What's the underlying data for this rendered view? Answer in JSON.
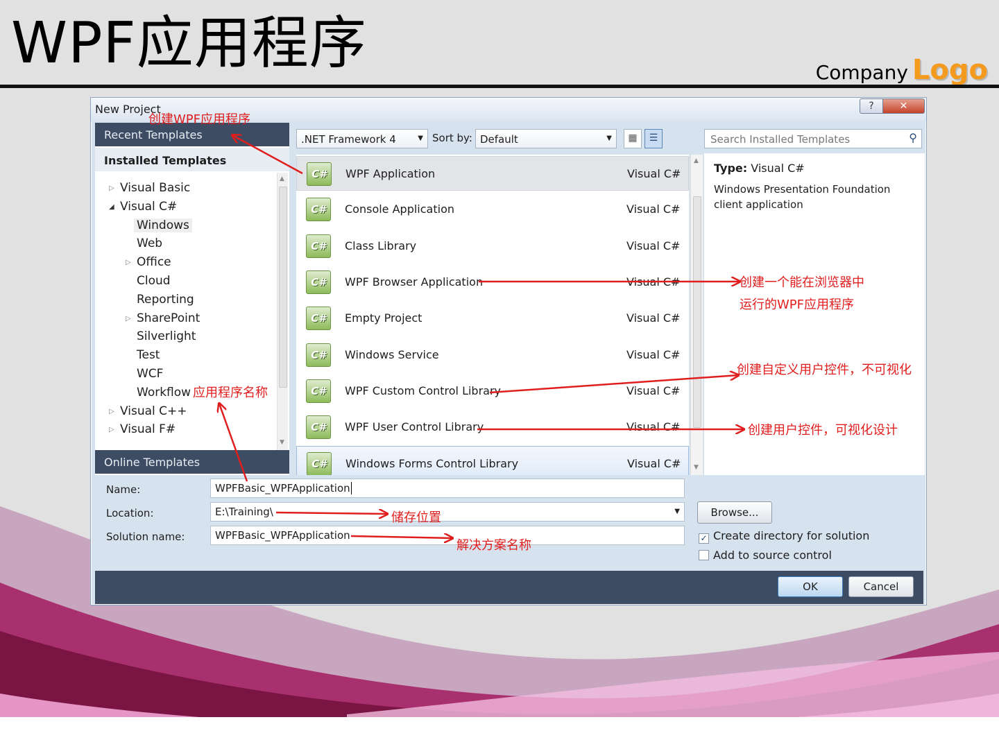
{
  "slide": {
    "title": "WPF应用程序",
    "company": "Company",
    "logo": "Logo"
  },
  "dialog": {
    "title": "New Project",
    "help_icon": "?",
    "close_icon": "✕",
    "left": {
      "recent_templates": "Recent Templates",
      "installed_templates": "Installed Templates",
      "tree": [
        {
          "label": "Visual Basic",
          "level": 0,
          "arrow": "collapsed"
        },
        {
          "label": "Visual C#",
          "level": 0,
          "arrow": "expanded"
        },
        {
          "label": "Windows",
          "level": 1,
          "arrow": "none",
          "selected": true
        },
        {
          "label": "Web",
          "level": 1,
          "arrow": "none"
        },
        {
          "label": "Office",
          "level": 1,
          "arrow": "collapsed"
        },
        {
          "label": "Cloud",
          "level": 1,
          "arrow": "none"
        },
        {
          "label": "Reporting",
          "level": 1,
          "arrow": "none"
        },
        {
          "label": "SharePoint",
          "level": 1,
          "arrow": "collapsed"
        },
        {
          "label": "Silverlight",
          "level": 1,
          "arrow": "none"
        },
        {
          "label": "Test",
          "level": 1,
          "arrow": "none"
        },
        {
          "label": "WCF",
          "level": 1,
          "arrow": "none"
        },
        {
          "label": "Workflow",
          "level": 1,
          "arrow": "none"
        },
        {
          "label": "Visual C++",
          "level": 0,
          "arrow": "collapsed"
        },
        {
          "label": "Visual F#",
          "level": 0,
          "arrow": "collapsed"
        }
      ],
      "online_templates": "Online Templates"
    },
    "toolbar": {
      "framework": ".NET Framework 4",
      "sort_label": "Sort by:",
      "sort_value": "Default",
      "search_placeholder": "Search Installed Templates"
    },
    "templates": [
      {
        "name": "WPF Application",
        "lang": "Visual C#",
        "state": "selected"
      },
      {
        "name": "Console Application",
        "lang": "Visual C#",
        "state": ""
      },
      {
        "name": "Class Library",
        "lang": "Visual C#",
        "state": ""
      },
      {
        "name": "WPF Browser Application",
        "lang": "Visual C#",
        "state": ""
      },
      {
        "name": "Empty Project",
        "lang": "Visual C#",
        "state": ""
      },
      {
        "name": "Windows Service",
        "lang": "Visual C#",
        "state": ""
      },
      {
        "name": "WPF Custom Control Library",
        "lang": "Visual C#",
        "state": ""
      },
      {
        "name": "WPF User Control Library",
        "lang": "Visual C#",
        "state": ""
      },
      {
        "name": "Windows Forms Control Library",
        "lang": "Visual C#",
        "state": "hovered"
      }
    ],
    "template_icon_text": "C#",
    "description": {
      "type_label": "Type:",
      "type_value": "Visual C#",
      "text": "Windows Presentation Foundation client application"
    },
    "form": {
      "name_label": "Name:",
      "name_value": "WPFBasic_WPFApplication",
      "location_label": "Location:",
      "location_value": "E:\\Training\\",
      "solution_label": "Solution name:",
      "solution_value": "WPFBasic_WPFApplication",
      "browse": "Browse...",
      "create_dir": "Create directory for solution",
      "create_dir_checked": true,
      "source_control": "Add to source control",
      "source_control_checked": false
    },
    "ok": "OK",
    "cancel": "Cancel"
  },
  "annotations": {
    "create_wpf": "创建WPF应用程序",
    "app_name": "应用程序名称",
    "browser_app_1": "创建一个能在浏览器中",
    "browser_app_2": "运行的WPF应用程序",
    "custom_control": "创建自定义用户控件，不可视化",
    "user_control": "创建用户控件，可视化设计",
    "location": "储存位置",
    "solution": "解决方案名称"
  },
  "colors": {
    "annotation": "#e01e1e",
    "logo": "#f49a1c",
    "dialog_header": "#3d4c63"
  }
}
